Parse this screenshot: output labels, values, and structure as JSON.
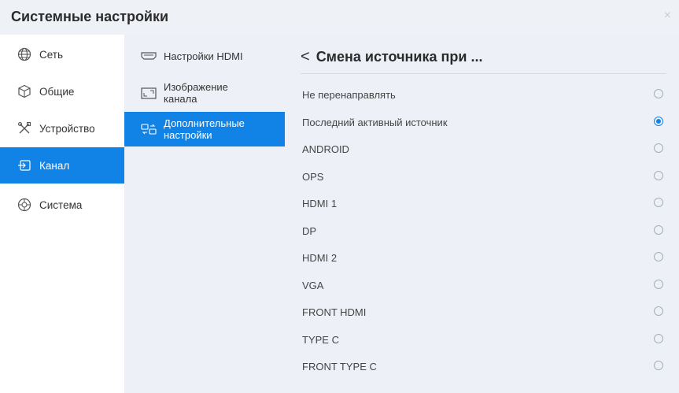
{
  "window": {
    "title": "Системные настройки",
    "close_glyph": "×"
  },
  "nav_primary": [
    {
      "label": "Сеть",
      "icon": "globe-icon"
    },
    {
      "label": "Общие",
      "icon": "cube-icon"
    },
    {
      "label": "Устройство",
      "icon": "tools-icon"
    },
    {
      "label": "Канал",
      "icon": "input-icon",
      "active": true
    },
    {
      "label": "Система",
      "icon": "system-icon"
    }
  ],
  "nav_secondary": [
    {
      "label": "Настройки HDMI",
      "icon": "hdmi-icon"
    },
    {
      "label": "Изображение канала",
      "icon": "picture-icon"
    },
    {
      "label": "Дополнительные настройки",
      "icon": "advanced-icon",
      "active": true
    }
  ],
  "panel": {
    "back_glyph": "<",
    "title": "Смена источника при ...",
    "options": [
      {
        "label": "Не перенаправлять",
        "selected": false
      },
      {
        "label": "Последний активный источник",
        "selected": true
      },
      {
        "label": "ANDROID",
        "selected": false
      },
      {
        "label": "OPS",
        "selected": false
      },
      {
        "label": "HDMI 1",
        "selected": false
      },
      {
        "label": "DP",
        "selected": false
      },
      {
        "label": "HDMI 2",
        "selected": false
      },
      {
        "label": "VGA",
        "selected": false
      },
      {
        "label": "FRONT HDMI",
        "selected": false
      },
      {
        "label": "TYPE C",
        "selected": false
      },
      {
        "label": "FRONT TYPE C",
        "selected": false
      }
    ]
  },
  "colors": {
    "accent": "#1283e6",
    "panel_bg": "#edf1f7",
    "titlebar_bg": "#eef1f6"
  }
}
